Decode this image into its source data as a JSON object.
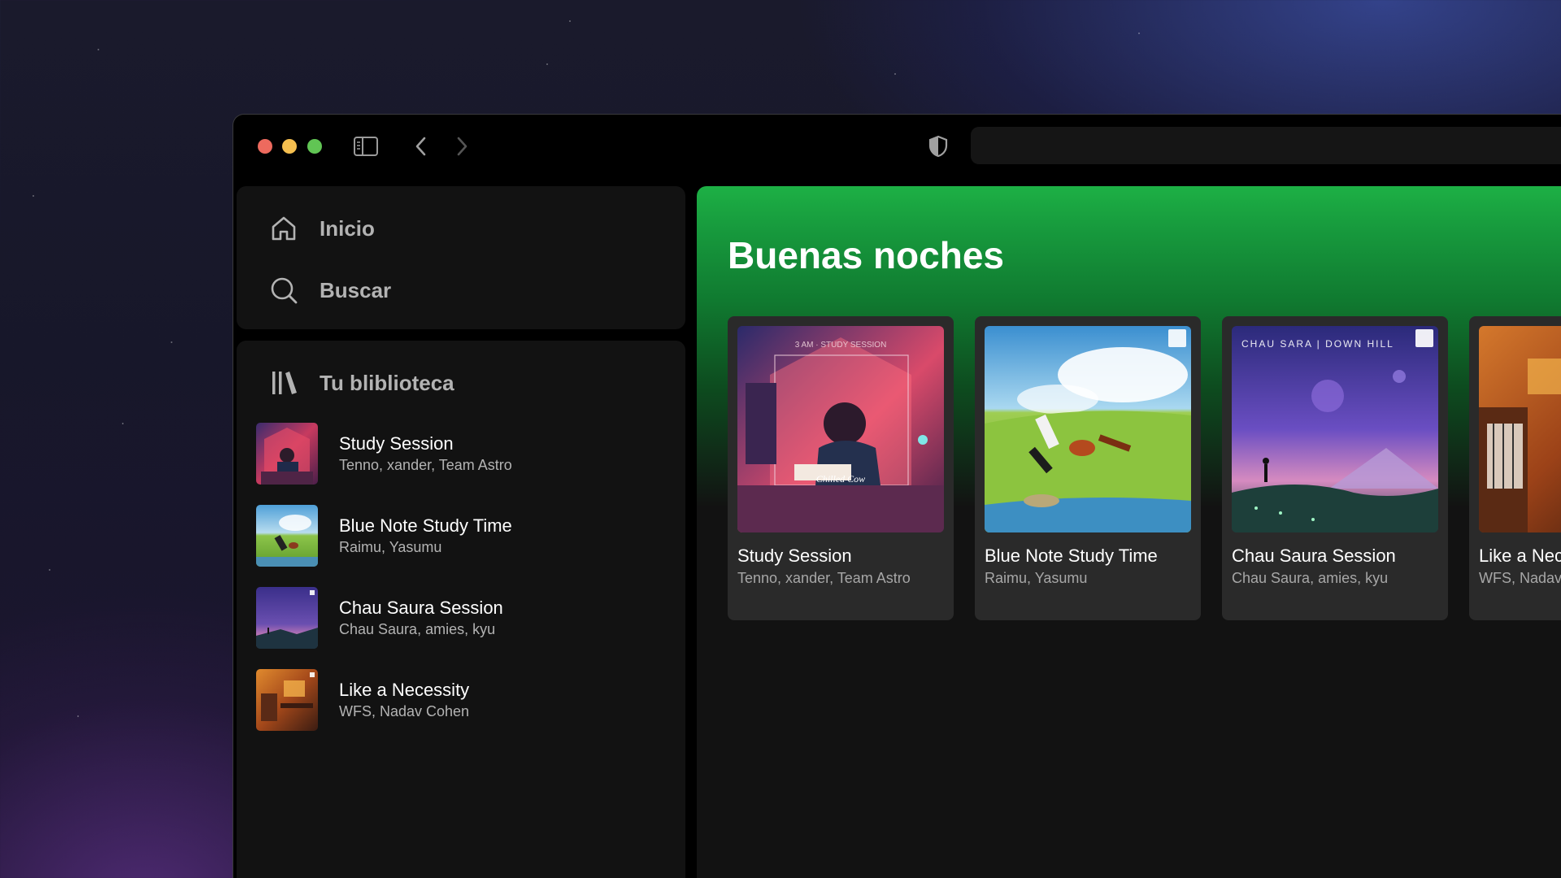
{
  "browser": {
    "address_placeholder": ""
  },
  "nav": {
    "home_label": "Inicio",
    "search_label": "Buscar"
  },
  "library": {
    "header_label": "Tu bliblioteca",
    "items": [
      {
        "title": "Study Session",
        "artists": "Tenno, xander, Team Astro"
      },
      {
        "title": "Blue Note Study Time",
        "artists": "Raimu, Yasumu"
      },
      {
        "title": "Chau Saura Session",
        "artists": "Chau Saura, amies, kyu"
      },
      {
        "title": "Like a Necessity",
        "artists": "WFS, Nadav Cohen"
      }
    ]
  },
  "main": {
    "greeting": "Buenas noches",
    "cards": [
      {
        "title": "Study Session",
        "artists": "Tenno, xander, Team Astro",
        "art_text_top": "3 AM  ·  STUDY SESSION",
        "art_text_bottom": "Chilled Cow"
      },
      {
        "title": "Blue Note Study Time",
        "artists": "Raimu, Yasumu"
      },
      {
        "title": "Chau Saura Session",
        "artists": "Chau Saura, amies, kyu",
        "art_text_top": "CHAU SARA  |  DOWN HILL"
      },
      {
        "title": "Like a Necessity",
        "artists": "WFS, Nadav Cohen"
      }
    ]
  },
  "colors": {
    "spotify_green": "#1db045",
    "panel_bg": "#121212",
    "card_bg": "#2a2a2a",
    "muted_text": "#b3b3b3"
  },
  "icons": {
    "sidebar_toggle": "sidebar-toggle-icon",
    "back": "chevron-left-icon",
    "forward": "chevron-right-icon",
    "shield": "shield-icon",
    "home": "home-icon",
    "search": "search-icon",
    "library": "library-icon"
  }
}
